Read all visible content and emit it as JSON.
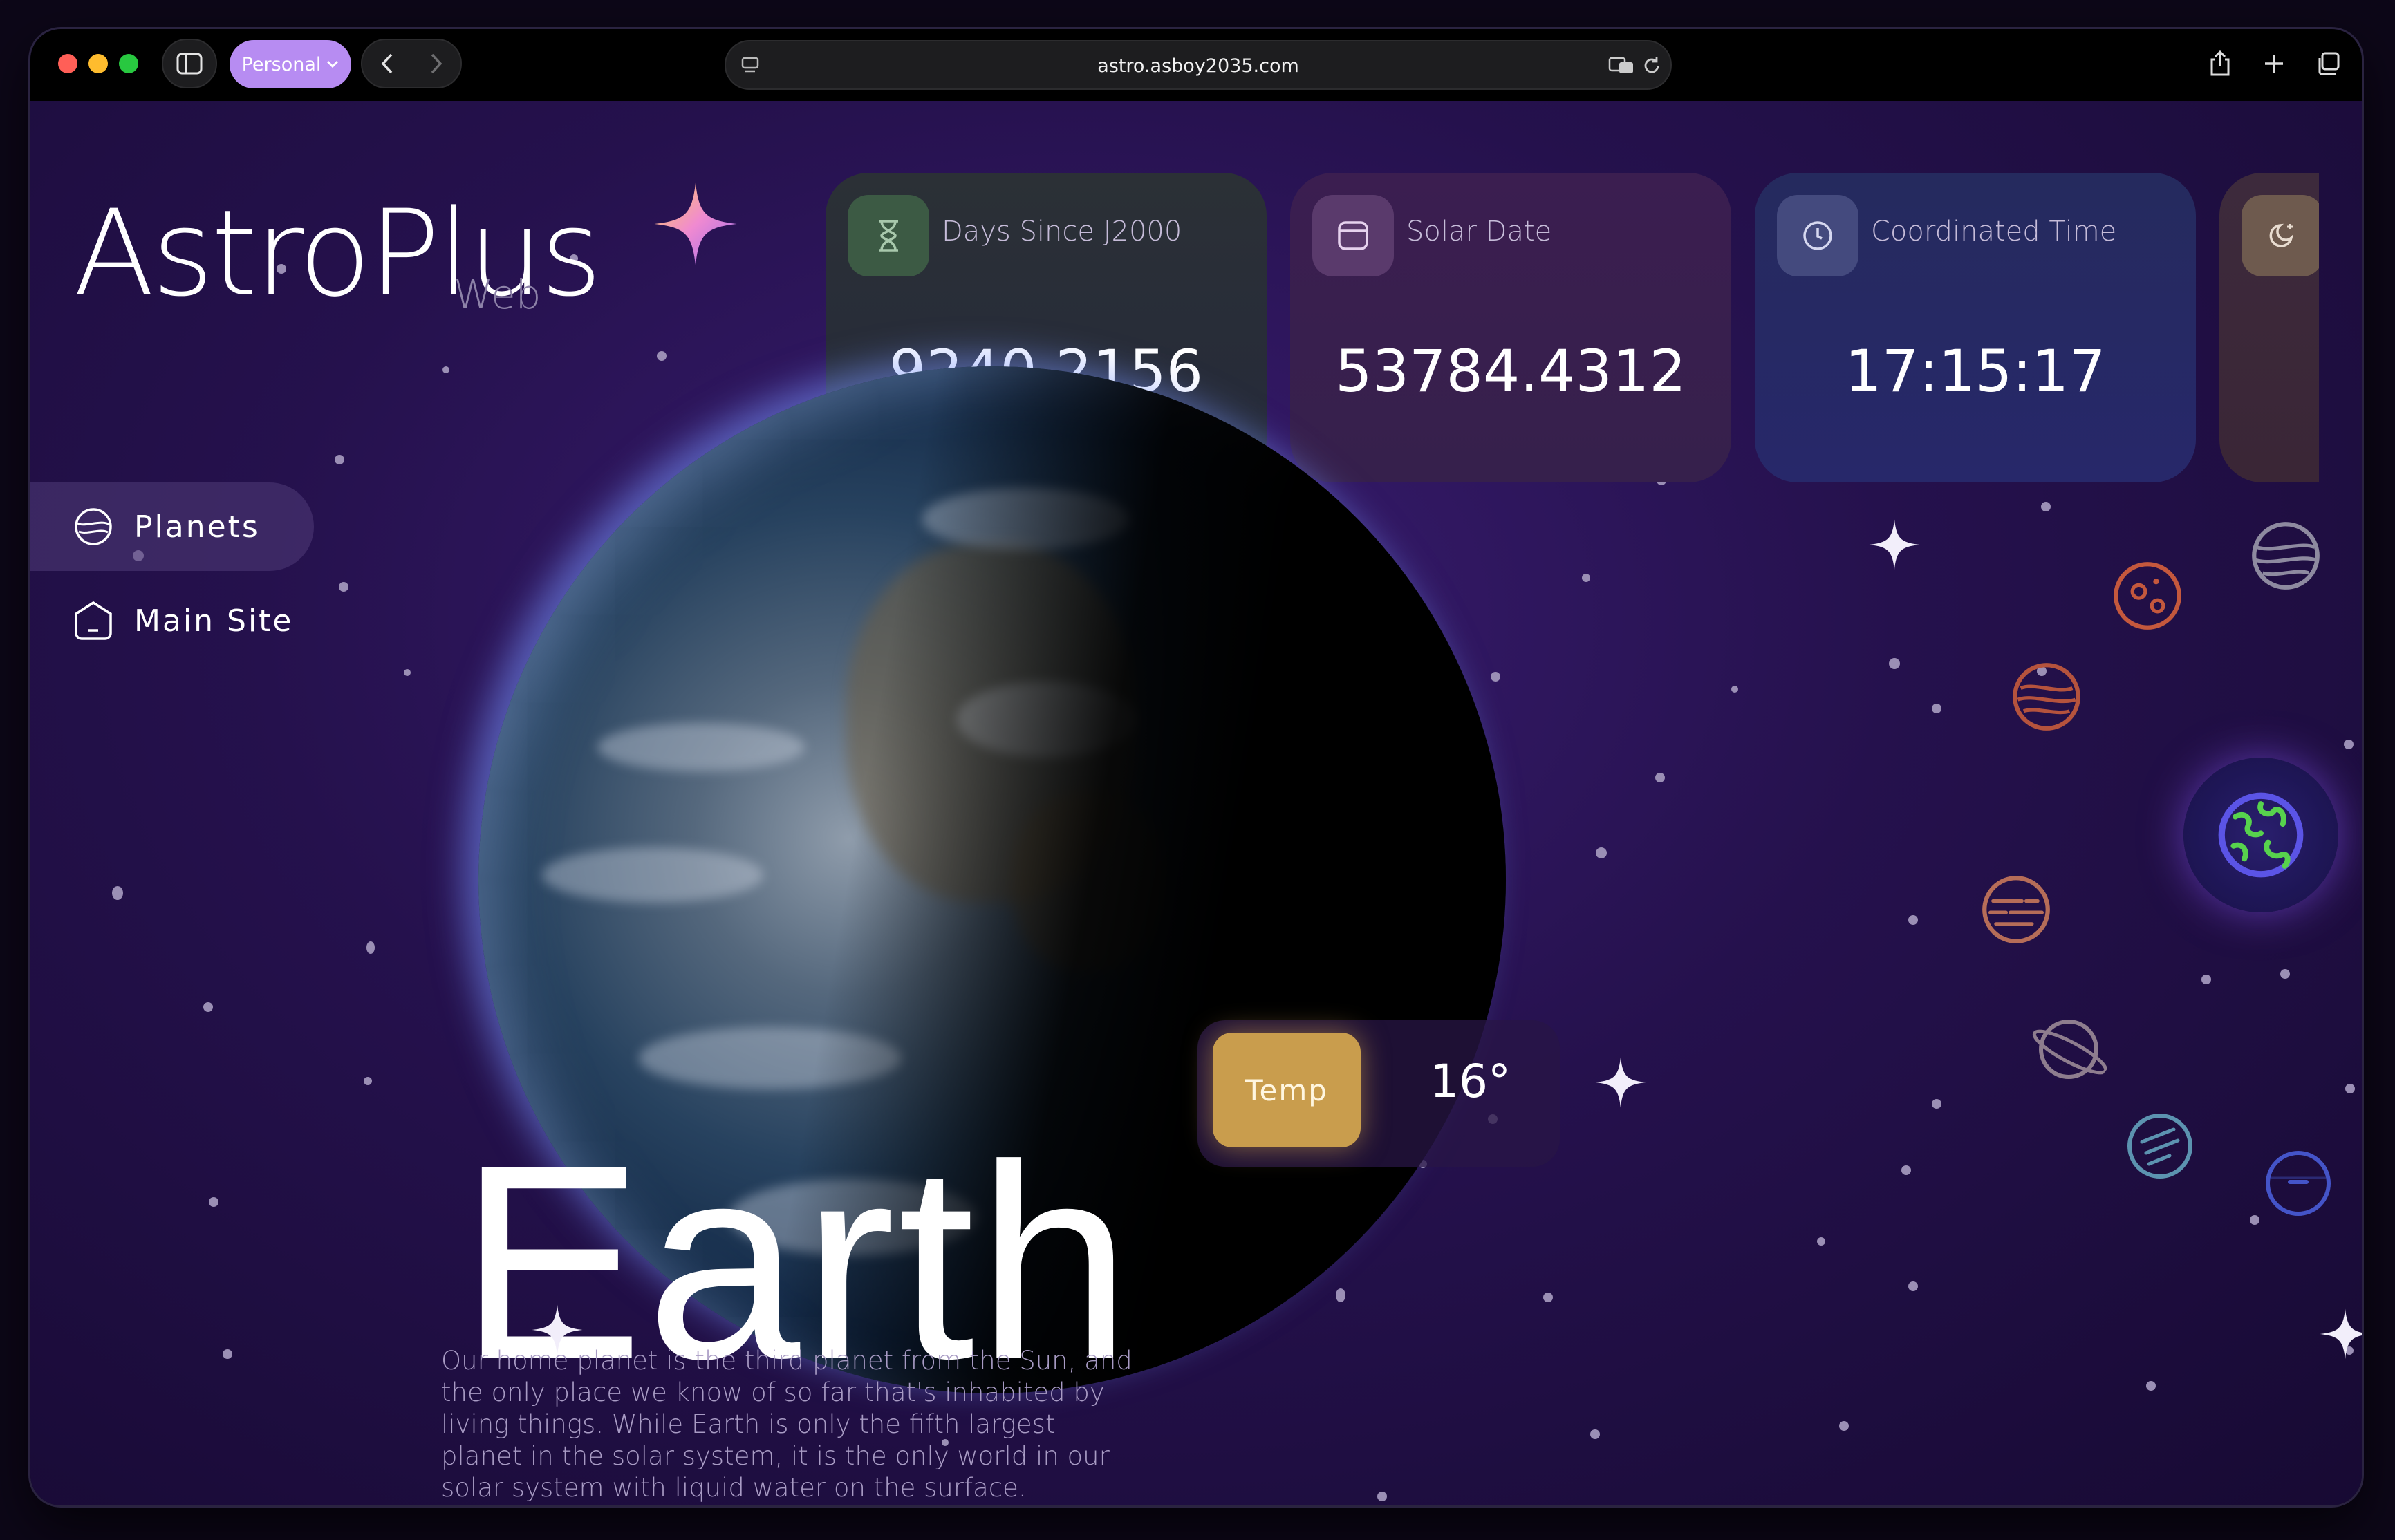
{
  "browser": {
    "profile_label": "Personal",
    "url": "astro.asboy2035.com"
  },
  "app": {
    "logo": "AstroPlus",
    "logo_sub": "Web"
  },
  "sidebar": {
    "items": [
      {
        "label": "Planets",
        "icon": "planet-icon",
        "active": true
      },
      {
        "label": "Main Site",
        "icon": "home-icon",
        "active": false
      }
    ]
  },
  "cards": [
    {
      "title": "Days Since J2000",
      "value": "9240.2156",
      "icon": "hourglass-icon",
      "color": "#2a3438"
    },
    {
      "title": "Solar Date",
      "value": "53784.4312",
      "icon": "calendar-icon",
      "color": "#3a1f4f"
    },
    {
      "title": "Coordinated Time",
      "value": "17:15:17",
      "icon": "clock-icon",
      "color": "#26285a"
    },
    {
      "title": "",
      "value": "",
      "icon": "moon-phase-icon",
      "color": "#3d2a3a"
    }
  ],
  "planet": {
    "name": "Earth",
    "description": "Our home planet is the third planet from the Sun, and the only place we know of so far that's inhabited by living things. While Earth is only the fifth largest planet in the solar system, it is the only world in our solar system with liquid water on the surface.",
    "temp_label": "Temp",
    "temp_value": "16°"
  },
  "planet_picker": [
    {
      "name": "jupiter-icon",
      "color": "#8e8aa0"
    },
    {
      "name": "mars-icon",
      "color": "#c4583d"
    },
    {
      "name": "venus-icon",
      "color": "#b5533d"
    },
    {
      "name": "earth-icon",
      "color": "#57d24d",
      "selected": true
    },
    {
      "name": "mercury-icon",
      "color": "#b66d58"
    },
    {
      "name": "saturn-icon",
      "color": "#8e7d8e"
    },
    {
      "name": "uranus-icon",
      "color": "#5c93b0"
    },
    {
      "name": "neptune-icon",
      "color": "#4454c8"
    }
  ]
}
